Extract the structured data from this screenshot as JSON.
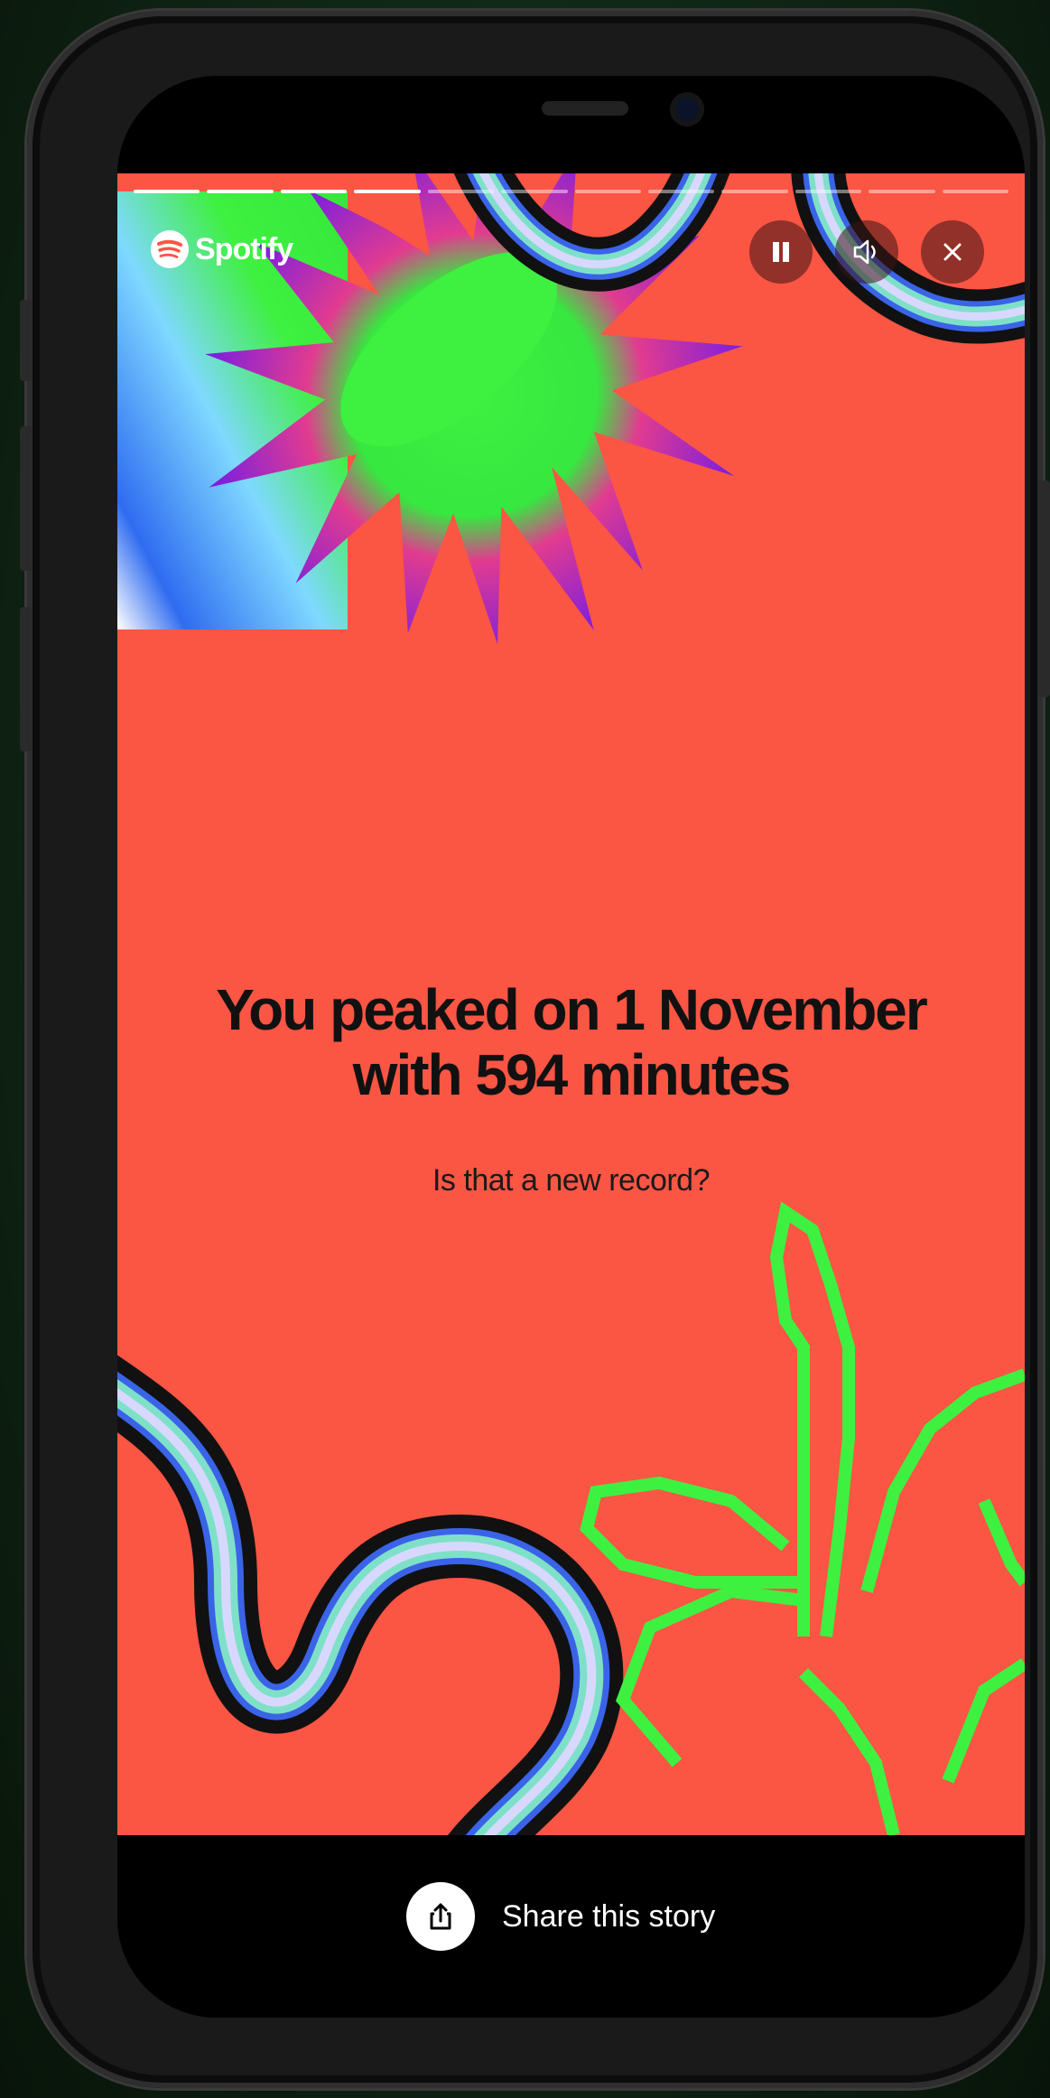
{
  "brand": {
    "name": "Spotify"
  },
  "progress": {
    "segments_total": 12,
    "segments_done": 4
  },
  "story": {
    "headline_line1": "You peaked on 1 November",
    "headline_line2": "with 594 minutes",
    "subtitle": "Is that a new record?"
  },
  "controls": {
    "pause_icon": "pause-icon",
    "volume_icon": "speaker-icon",
    "close_icon": "close-icon"
  },
  "share": {
    "label": "Share this story",
    "icon": "share-icon"
  },
  "colors": {
    "story_background": "#fb5544",
    "accent_green": "#3ef040",
    "accent_purple": "#8a22e8",
    "text_dark": "#111111"
  }
}
